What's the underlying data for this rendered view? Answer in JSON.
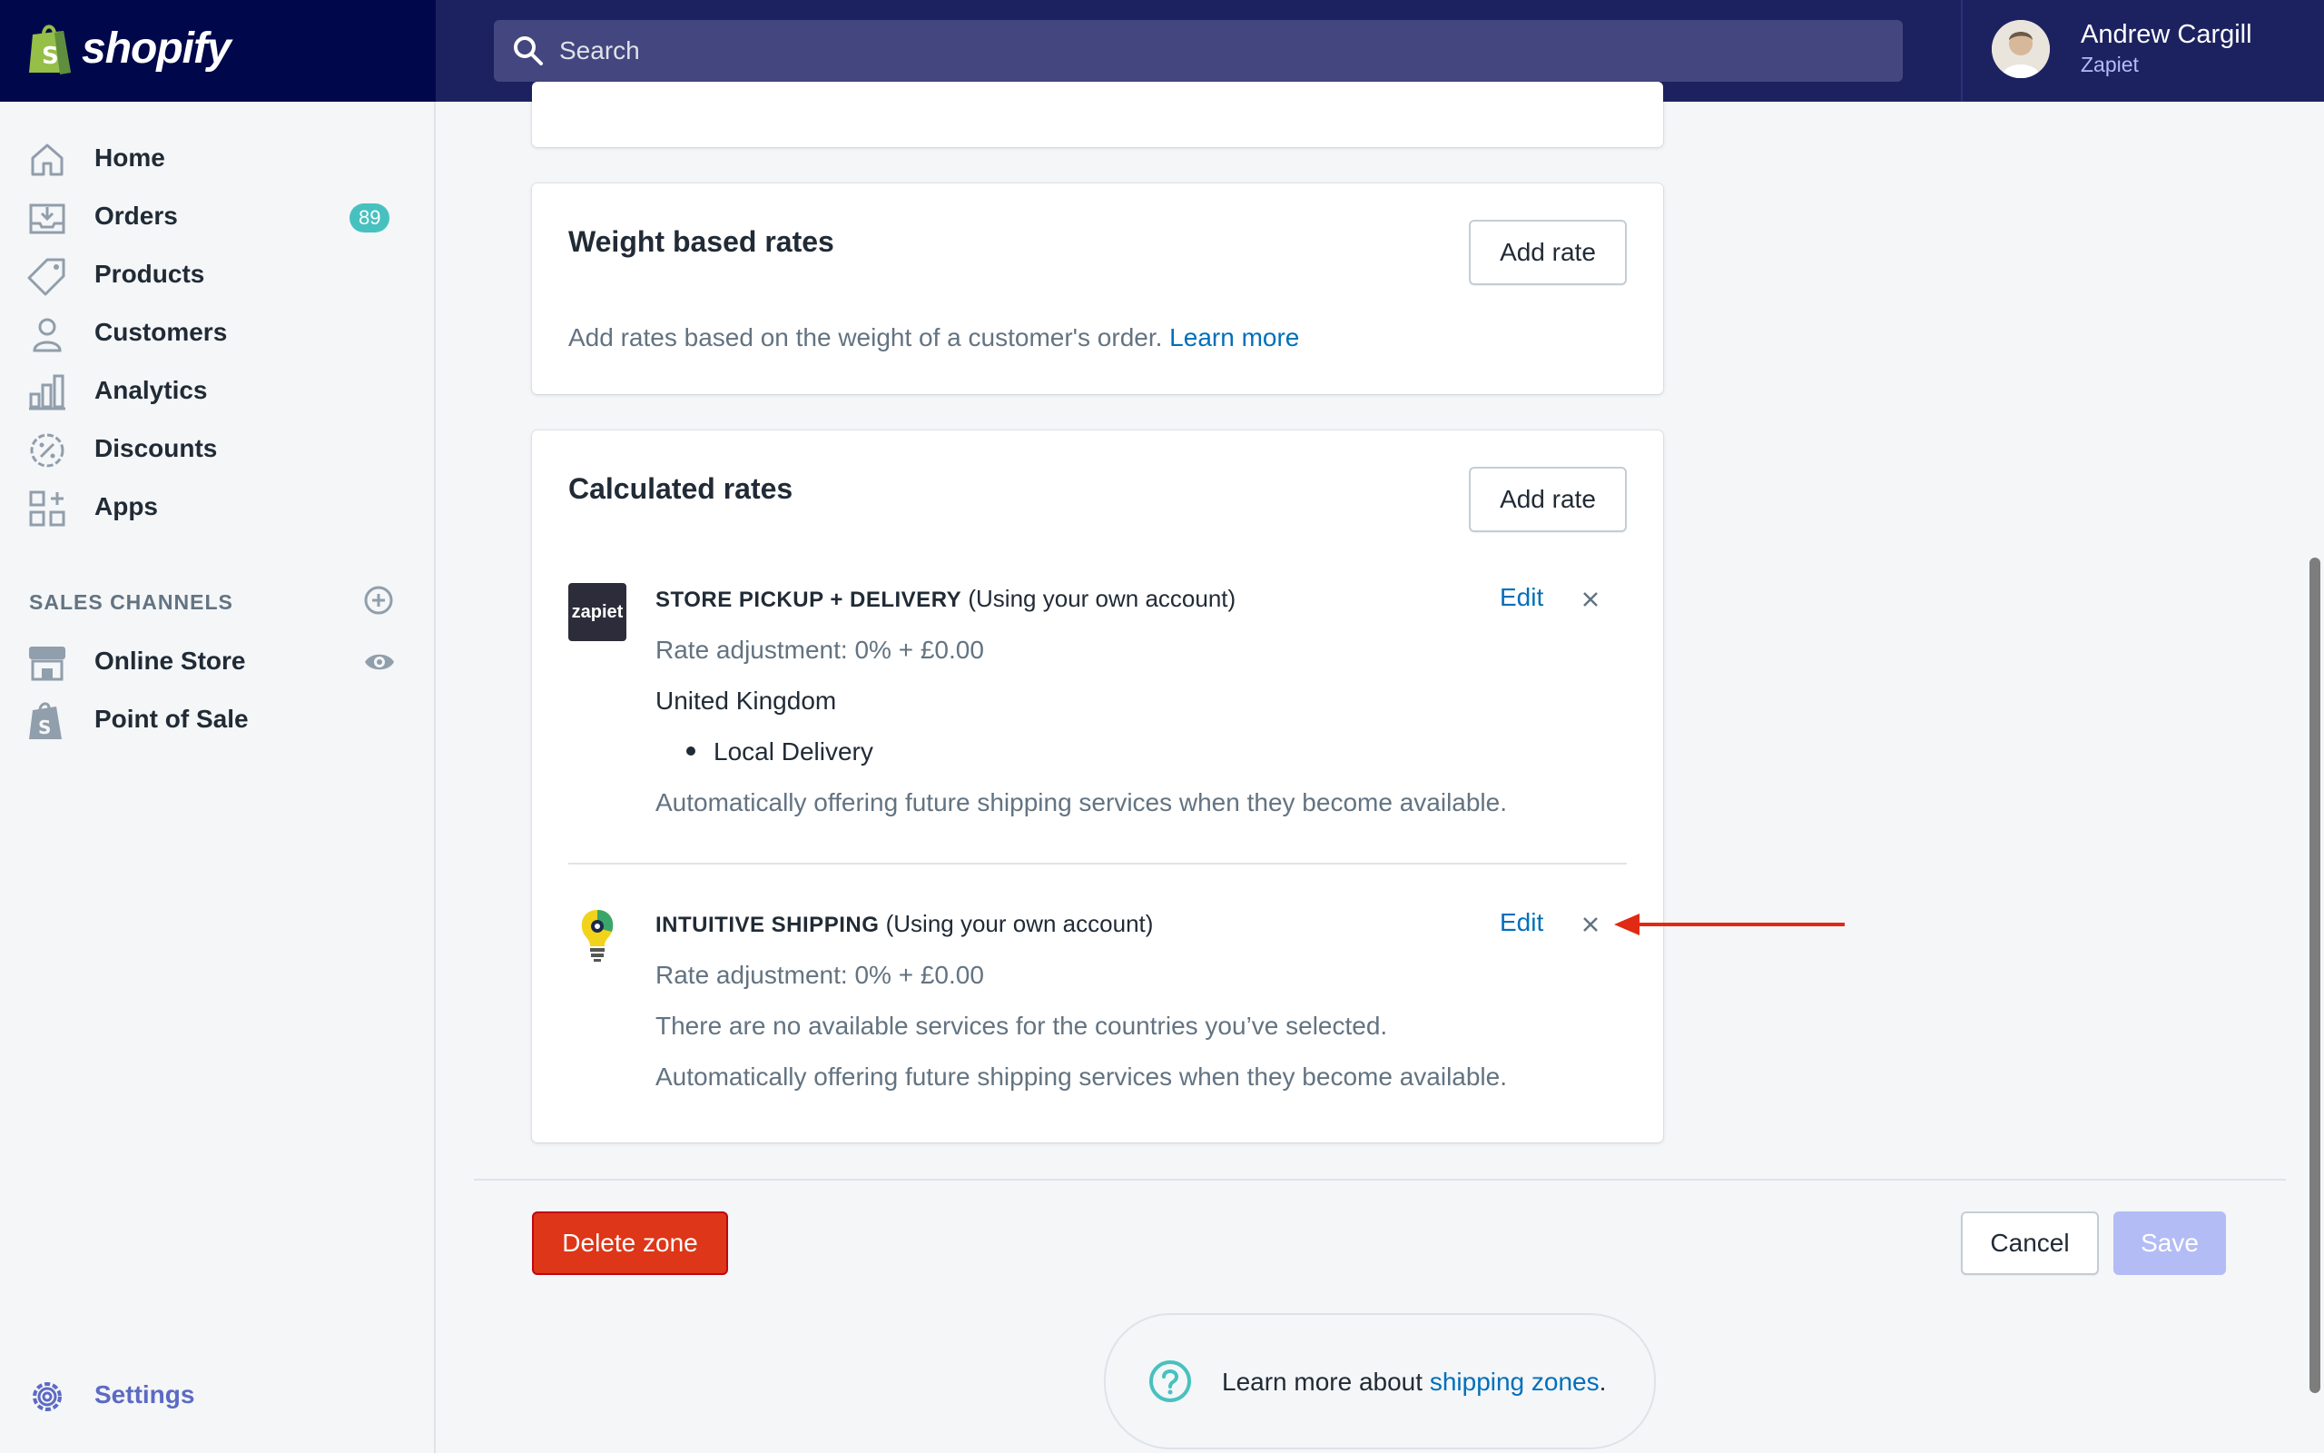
{
  "topbar": {
    "logo_text": "shopify",
    "search_placeholder": "Search",
    "user_name": "Andrew Cargill",
    "user_store": "Zapiet"
  },
  "sidebar": {
    "items": [
      {
        "label": "Home",
        "icon": "home-icon"
      },
      {
        "label": "Orders",
        "icon": "orders-icon",
        "badge": "89"
      },
      {
        "label": "Products",
        "icon": "tag-icon"
      },
      {
        "label": "Customers",
        "icon": "person-icon"
      },
      {
        "label": "Analytics",
        "icon": "bar-chart-icon"
      },
      {
        "label": "Discounts",
        "icon": "discount-icon"
      },
      {
        "label": "Apps",
        "icon": "apps-icon"
      }
    ],
    "sales_channels_title": "SALES CHANNELS",
    "channels": [
      {
        "label": "Online Store",
        "icon": "store-icon"
      },
      {
        "label": "Point of Sale",
        "icon": "shopify-bag-icon"
      }
    ],
    "settings_label": "Settings"
  },
  "weight_card": {
    "title": "Weight based rates",
    "add_rate": "Add rate",
    "description": "Add rates based on the weight of a customer's order.",
    "learn_more": "Learn more"
  },
  "calculated_card": {
    "title": "Calculated rates",
    "add_rate": "Add rate",
    "services": [
      {
        "logo_text": "zapiet",
        "name": "STORE PICKUP + DELIVERY",
        "account": "(Using your own account)",
        "edit": "Edit",
        "rate_adjustment": "Rate adjustment: 0% + £0.00",
        "country": "United Kingdom",
        "service_item": "Local Delivery",
        "auto_text": "Automatically offering future shipping services when they become available."
      },
      {
        "name": "INTUITIVE SHIPPING",
        "account": "(Using your own account)",
        "edit": "Edit",
        "rate_adjustment": "Rate adjustment: 0% + £0.00",
        "no_services": "There are no available services for the countries you’ve selected.",
        "auto_text": "Automatically offering future shipping services when they become available."
      }
    ]
  },
  "footer": {
    "delete_zone": "Delete zone",
    "cancel": "Cancel",
    "save": "Save",
    "help_text": "Learn more about",
    "help_link": "shipping zones",
    "help_suffix": "."
  },
  "colors": {
    "topbar": "#1c2260",
    "accent": "#5c6ac4",
    "link": "#006fbb",
    "danger": "#de3618",
    "annotation_arrow": "#e02a13"
  }
}
